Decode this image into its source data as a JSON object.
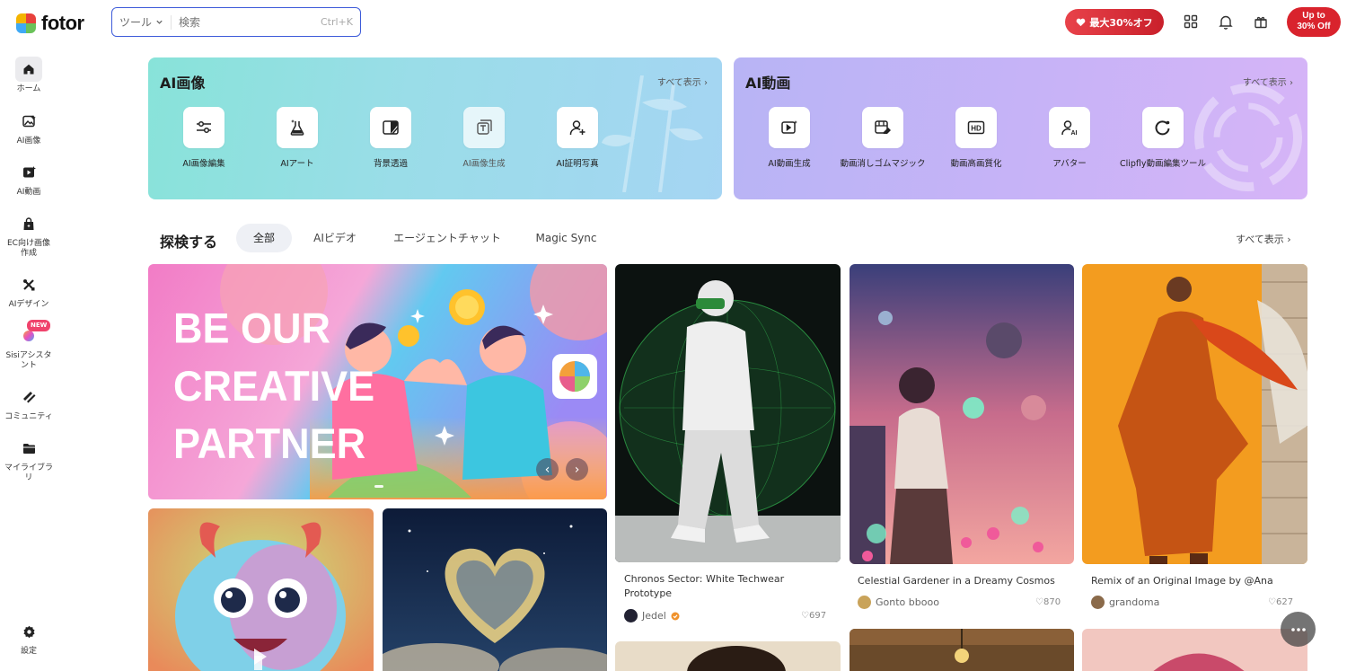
{
  "header": {
    "logo_text": "fotor",
    "search": {
      "tool_label": "ツール",
      "placeholder": "検索",
      "shortcut": "Ctrl+K"
    },
    "promo_label": "最大30%オフ",
    "upto_line1": "Up to",
    "upto_line2": "30% Off"
  },
  "sidebar": {
    "items": [
      {
        "label": "ホーム",
        "icon": "home-icon"
      },
      {
        "label": "AI画像",
        "icon": "ai-image-icon"
      },
      {
        "label": "AI動画",
        "icon": "ai-video-icon"
      },
      {
        "label": "EC向け画像作成",
        "icon": "shopping-bag-icon"
      },
      {
        "label": "AIデザイン",
        "icon": "design-tools-icon"
      },
      {
        "label": "Sisiアシスタント",
        "icon": "sisi-icon",
        "badge": "NEW"
      },
      {
        "label": "コミュニティ",
        "icon": "community-icon"
      },
      {
        "label": "マイライブラリ",
        "icon": "folder-icon"
      },
      {
        "label": "設定",
        "icon": "settings-icon"
      }
    ]
  },
  "ai_image": {
    "title": "AI画像",
    "see_all": "すべて表示",
    "tools": [
      {
        "label": "AI画像編集",
        "icon": "sliders-icon"
      },
      {
        "label": "AIアート",
        "icon": "flask-icon"
      },
      {
        "label": "背景透過",
        "icon": "bg-remove-icon"
      },
      {
        "label": "AI画像生成",
        "icon": "image-gen-icon"
      },
      {
        "label": "AI証明写真",
        "icon": "id-photo-icon"
      }
    ]
  },
  "ai_video": {
    "title": "AI動画",
    "see_all": "すべて表示",
    "tools": [
      {
        "label": "AI動画生成",
        "icon": "video-gen-icon"
      },
      {
        "label": "動画消しゴムマジック",
        "icon": "video-eraser-icon"
      },
      {
        "label": "動画高画質化",
        "icon": "hd-icon"
      },
      {
        "label": "アバター",
        "icon": "avatar-ai-icon"
      },
      {
        "label": "Clipfly動画編集ツール",
        "icon": "clipfly-icon"
      }
    ]
  },
  "explore": {
    "title": "探検する",
    "tabs": [
      "全部",
      "AIビデオ",
      "エージェントチャット",
      "Magic Sync"
    ],
    "see_all": "すべて表示"
  },
  "hero": {
    "line1": "BE OUR",
    "line2": "CREATIVE",
    "line3": "PARTNER"
  },
  "cards": [
    {
      "title": "Chronos Sector: White Techwear Prototype",
      "user": "Jedel",
      "likes": "697"
    },
    {
      "title": "Celestial Gardener in a Dreamy Cosmos",
      "user": "Gonto bbooo",
      "likes": "870"
    },
    {
      "title": "Remix of an Original Image by @Ana",
      "user": "grandoma",
      "likes": "627"
    }
  ],
  "colors": {
    "accent_red": "#d9232d",
    "search_border": "#3d5bd9",
    "ai_image_bg": "#9adde8",
    "ai_video_bg": "#c6b3f7"
  }
}
